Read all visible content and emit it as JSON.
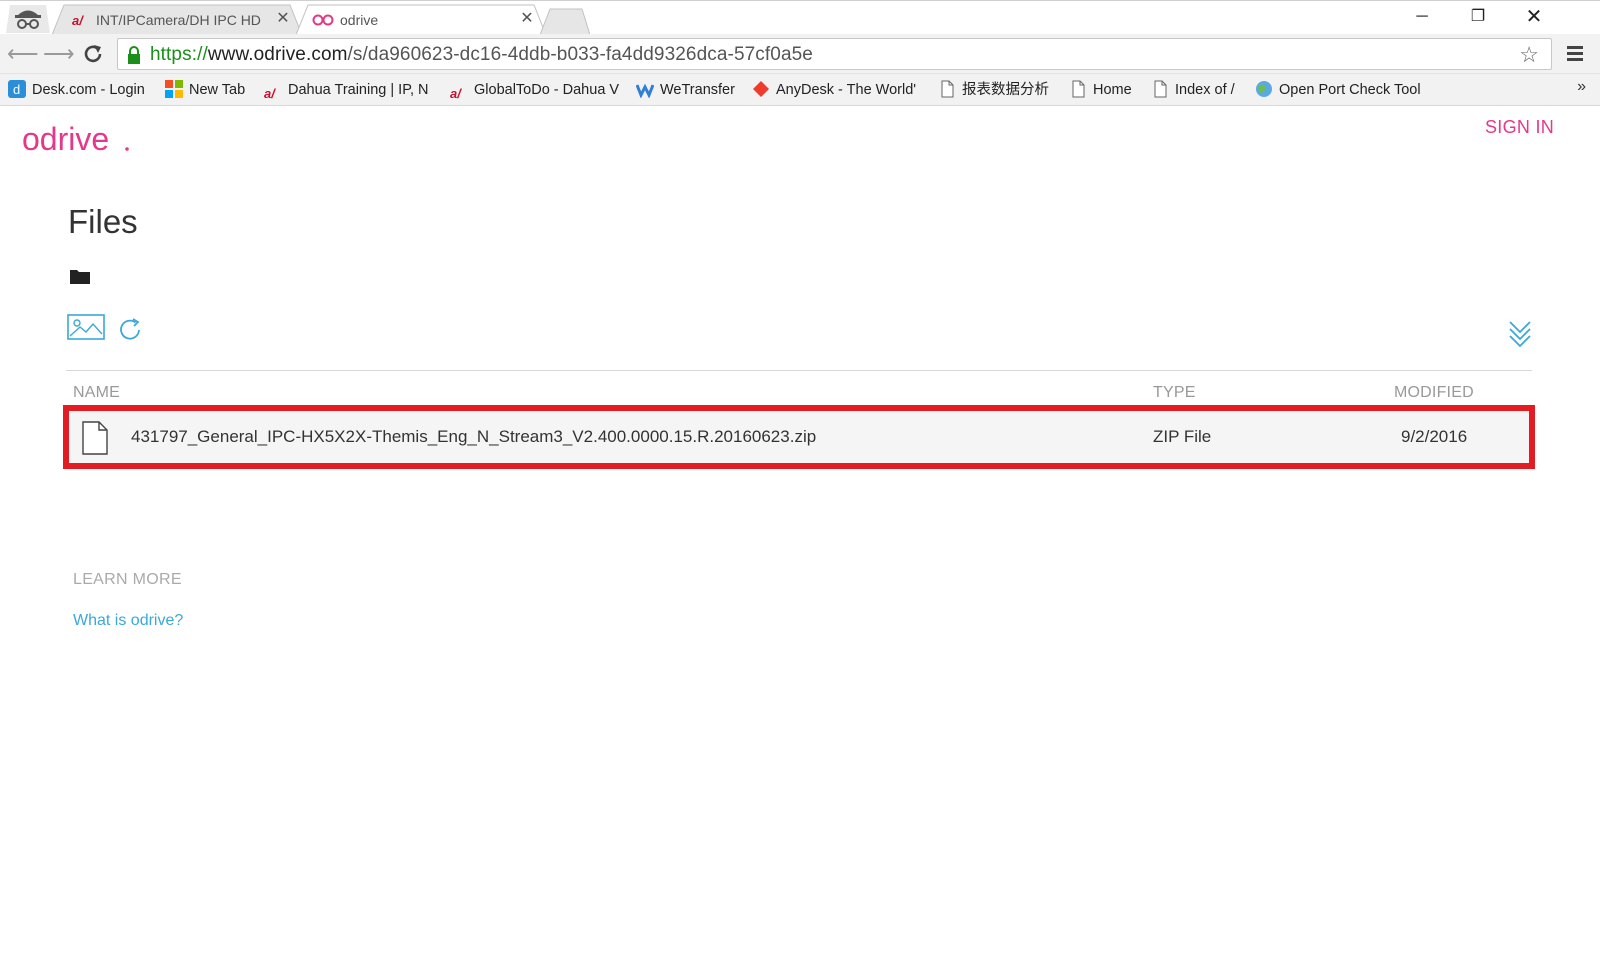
{
  "browser": {
    "tabs": [
      {
        "favicon": "a/",
        "title": "INT/IPCamera/DH IPC HD"
      },
      {
        "favicon": "odrive-icon",
        "title": "odrive"
      }
    ],
    "url": {
      "scheme": "https://",
      "host": "www.odrive.com",
      "path": "/s/da960623-dc16-4ddb-b033-fa4dd9326dca-57cf0a5e"
    },
    "bookmarks": [
      {
        "icon": "desk-icon",
        "label": "Desk.com - Login"
      },
      {
        "icon": "windows-icon",
        "label": "New Tab"
      },
      {
        "icon": "dahua-icon",
        "label": "Dahua Training | IP, N"
      },
      {
        "icon": "dahua-icon",
        "label": "GlobalToDo - Dahua V"
      },
      {
        "icon": "wetransfer-icon",
        "label": "WeTransfer"
      },
      {
        "icon": "anydesk-icon",
        "label": "AnyDesk - The World'"
      },
      {
        "icon": "page-icon",
        "label": "报表数据分析"
      },
      {
        "icon": "page-icon",
        "label": "Home"
      },
      {
        "icon": "page-icon",
        "label": "Index of /"
      },
      {
        "icon": "globe-icon",
        "label": "Open Port Check Tool"
      }
    ],
    "more_bookmarks": "»"
  },
  "header": {
    "logo_text": "odrive",
    "sign_in": "SIGN IN"
  },
  "main": {
    "title": "Files",
    "columns": {
      "name": "NAME",
      "type": "TYPE",
      "modified": "MODIFIED"
    },
    "files": [
      {
        "name": "431797_General_IPC-HX5X2X-Themis_Eng_N_Stream3_V2.400.0000.15.R.20160623.zip",
        "type": "ZIP File",
        "modified": "9/2/2016"
      }
    ],
    "learn_more": {
      "heading": "LEARN MORE",
      "link": "What is odrive?"
    }
  },
  "colors": {
    "accent": "#e4388a",
    "link": "#3aa8d8",
    "highlight": "#e31b23"
  }
}
